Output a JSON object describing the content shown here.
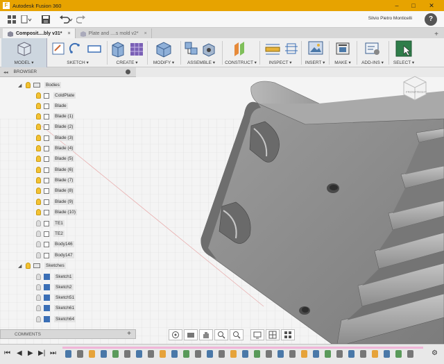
{
  "app": {
    "icon_letter": "F",
    "title": "Autodesk Fusion 360",
    "minimize": "–",
    "maximize": "□",
    "close": "✕"
  },
  "qat": {
    "user": "Silvio Pietro Monticelli",
    "help": "?"
  },
  "tabs": [
    {
      "label": "Composit....bly v31*",
      "close": "×"
    },
    {
      "label": "Plate and ....s mold v2*",
      "close": "×"
    }
  ],
  "toolbar": {
    "model": "MODEL ▾",
    "sketch": "SKETCH ▾",
    "create": "CREATE ▾",
    "modify": "MODIFY ▾",
    "assemble": "ASSEMBLE ▾",
    "construct": "CONSTRUCT ▾",
    "inspect": "INSPECT ▾",
    "insert": "INSERT ▾",
    "make": "MAKE ▾",
    "addins": "ADD-INS ▾",
    "select": "SELECT ▾"
  },
  "browser": {
    "title": "BROWSER",
    "collapse": "◂◂",
    "items": [
      {
        "label": "Bodies",
        "bulb": true,
        "type": "folder",
        "level": 0
      },
      {
        "label": "ColdPlate",
        "bulb": true,
        "type": "body",
        "level": 1
      },
      {
        "label": "Blade",
        "bulb": true,
        "type": "body",
        "level": 1
      },
      {
        "label": "Blade (1)",
        "bulb": true,
        "type": "body",
        "level": 1
      },
      {
        "label": "Blade (2)",
        "bulb": true,
        "type": "body",
        "level": 1
      },
      {
        "label": "Blade (3)",
        "bulb": true,
        "type": "body",
        "level": 1
      },
      {
        "label": "Blade (4)",
        "bulb": true,
        "type": "body",
        "level": 1
      },
      {
        "label": "Blade (5)",
        "bulb": true,
        "type": "body",
        "level": 1
      },
      {
        "label": "Blade (6)",
        "bulb": true,
        "type": "body",
        "level": 1
      },
      {
        "label": "Blade (7)",
        "bulb": true,
        "type": "body",
        "level": 1
      },
      {
        "label": "Blade (8)",
        "bulb": true,
        "type": "body",
        "level": 1
      },
      {
        "label": "Blade (9)",
        "bulb": true,
        "type": "body",
        "level": 1
      },
      {
        "label": "Blade (10)",
        "bulb": true,
        "type": "body",
        "level": 1
      },
      {
        "label": "TE1",
        "bulb": false,
        "type": "body",
        "level": 1
      },
      {
        "label": "TE2",
        "bulb": false,
        "type": "body",
        "level": 1
      },
      {
        "label": "Body146",
        "bulb": false,
        "type": "body",
        "level": 1
      },
      {
        "label": "Body147",
        "bulb": false,
        "type": "body",
        "level": 1
      },
      {
        "label": "Sketches",
        "bulb": true,
        "type": "folder",
        "level": 0
      },
      {
        "label": "Sketch1",
        "bulb": false,
        "type": "sketch",
        "level": 1
      },
      {
        "label": "Sketch2",
        "bulb": false,
        "type": "sketch",
        "level": 1
      },
      {
        "label": "Sketch51",
        "bulb": false,
        "type": "sketch",
        "level": 1
      },
      {
        "label": "Sketch61",
        "bulb": false,
        "type": "sketch",
        "level": 1
      },
      {
        "label": "Sketch64",
        "bulb": false,
        "type": "sketch",
        "level": 1
      }
    ]
  },
  "comments": {
    "title": "COMMENTS",
    "add": "+"
  },
  "viewcube": {
    "face_front": "FRONT",
    "face_right": "RIGHT"
  },
  "timeline": {
    "first": "⏮",
    "prev": "◀",
    "play": "▶",
    "next": "▶|",
    "last": "⏭",
    "settings": "⚙"
  },
  "colors": {
    "titlebar": "#e7a300",
    "body": "#8a8a8a",
    "body_dark": "#5a5a5a",
    "bulb_on": "#f3c233"
  }
}
